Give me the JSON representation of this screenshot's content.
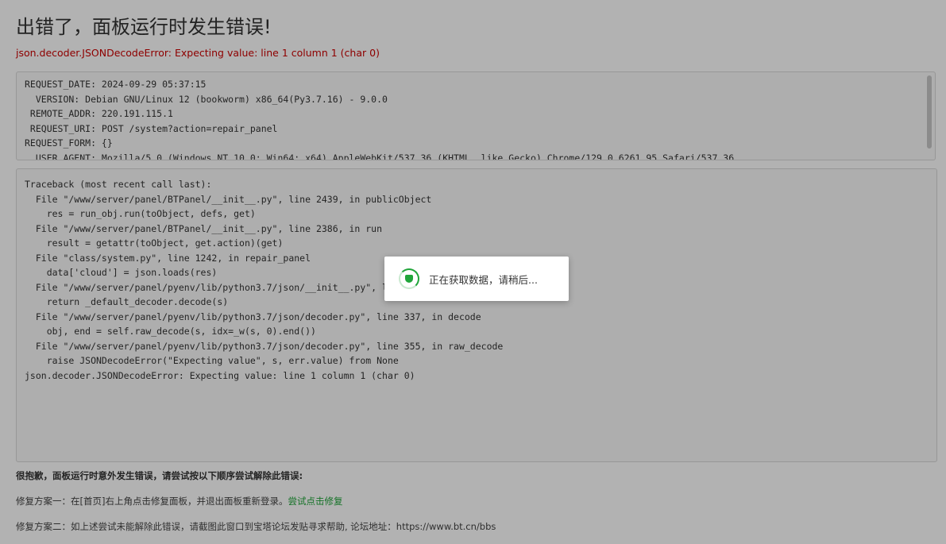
{
  "page": {
    "title": "出错了，面板运行时发生错误!",
    "error_summary": "json.decoder.JSONDecodeError: Expecting value: line 1 column 1 (char 0)"
  },
  "request_info": {
    "lines": [
      "REQUEST_DATE: 2024-09-29 05:37:15",
      "  VERSION: Debian GNU/Linux 12 (bookworm) x86_64(Py3.7.16) - 9.0.0",
      " REMOTE_ADDR: 220.191.115.1",
      " REQUEST_URI: POST /system?action=repair_panel",
      "REQUEST_FORM: {}",
      "  USER_AGENT: Mozilla/5.0 (Windows NT 10.0; Win64; x64) AppleWebKit/537.36 (KHTML, like Gecko) Chrome/129.0.6261.95 Safari/537.36"
    ]
  },
  "traceback": {
    "lines": [
      "Traceback (most recent call last):",
      "  File \"/www/server/panel/BTPanel/__init__.py\", line 2439, in publicObject",
      "    res = run_obj.run(toObject, defs, get)",
      "  File \"/www/server/panel/BTPanel/__init__.py\", line 2386, in run",
      "    result = getattr(toObject, get.action)(get)",
      "  File \"class/system.py\", line 1242, in repair_panel",
      "    data['cloud'] = json.loads(res)",
      "  File \"/www/server/panel/pyenv/lib/python3.7/json/__init__.py\", line 348, in loads",
      "    return _default_decoder.decode(s)",
      "  File \"/www/server/panel/pyenv/lib/python3.7/json/decoder.py\", line 337, in decode",
      "    obj, end = self.raw_decode(s, idx=_w(s, 0).end())",
      "  File \"/www/server/panel/pyenv/lib/python3.7/json/decoder.py\", line 355, in raw_decode",
      "    raise JSONDecodeError(\"Expecting value\", s, err.value) from None",
      "json.decoder.JSONDecodeError: Expecting value: line 1 column 1 (char 0)"
    ]
  },
  "footer": {
    "apology": "很抱歉，面板运行时意外发生错误，请尝试按以下顺序尝试解除此错误:",
    "fix1_text": "修复方案一：在[首页]右上角点击修复面板，并退出面板重新登录。",
    "fix1_link": "尝试点击修复",
    "fix2_text": "修复方案二：如上述尝试未能解除此错误，请截图此窗口到宝塔论坛发贴寻求帮助, 论坛地址：https://www.bt.cn/bbs"
  },
  "loading": {
    "message": "正在获取数据，请稍后...",
    "icon": "loading-spinner-icon"
  },
  "colors": {
    "error": "#cc0000",
    "accent": "#20a53a",
    "overlay": "rgba(0,0,0,0.3)"
  }
}
